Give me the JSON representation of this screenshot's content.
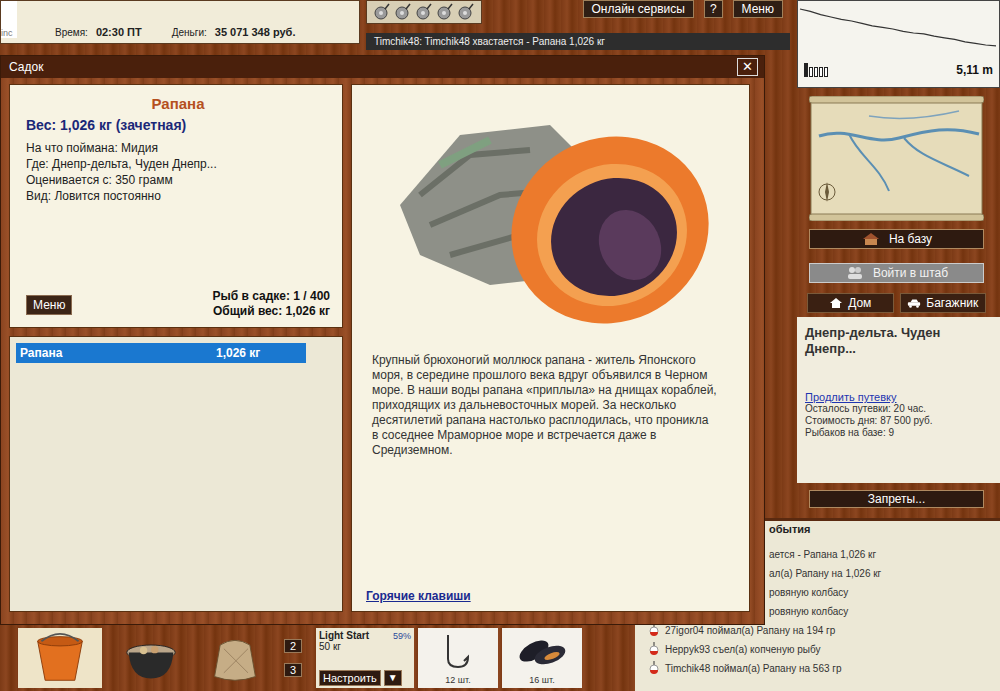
{
  "edge_fragment": "inc",
  "status": {
    "time_label": "Время:",
    "time": "02:30 ПТ",
    "money_label": "Деньги:",
    "money": "35 071 348 руб."
  },
  "top_buttons": {
    "online": "Онлайн сервисы",
    "help": "?",
    "menu": "Меню"
  },
  "chat": "Timchik48: Timchik48 хвастается - Рапана 1,026 кг",
  "depth": {
    "reading": "5,11 m",
    "profile": [
      0.5,
      0.8,
      1.2,
      1.5,
      1.8,
      2.0,
      2.3,
      2.6,
      2.8,
      3.0,
      3.3,
      3.5,
      3.6,
      3.9,
      4.1,
      4.3,
      4.6,
      4.8,
      5.0,
      5.11
    ],
    "battery": {
      "level": 0.2
    }
  },
  "right_panel": {
    "base_button": "На базу",
    "hq_button": {
      "label": "Войти в штаб",
      "disabled": true
    },
    "tabs": [
      {
        "label": "Дом",
        "kind": "home",
        "selected": false
      },
      {
        "label": "Багажник",
        "kind": "trunk",
        "selected": false
      }
    ],
    "location": "Днепр-дельта. Чуден Днепр...",
    "extend_link": "Продлить путевку",
    "info": [
      "Осталось путевки: 20 час.",
      "Стоимость дня: 87 500 руб.",
      "Рыбаков на базе: 9"
    ],
    "bans_button": "Запреты..."
  },
  "events": {
    "title": "обытия",
    "title_partial": true,
    "items": [
      {
        "text": "ается - Рапана 1,026 кг",
        "partial": true
      },
      {
        "text": "ал(а) Рапану на 1,026 кг",
        "partial": true
      },
      {
        "text": "ровяную колбасу",
        "partial": true
      },
      {
        "text": "ровяную колбасу",
        "partial": true
      },
      {
        "text": "27igor04 поймал(а) Рапану на 194 гр",
        "partial": false
      },
      {
        "text": "Heppyk93 съел(а) копченую рыбу",
        "partial": false
      },
      {
        "text": "Timchik48 поймал(а) Рапану на 563 гр",
        "partial": false
      }
    ]
  },
  "toolbar": {
    "tools": [
      {
        "kind": "bucket",
        "selected": true
      },
      {
        "kind": "pot",
        "selected": false
      },
      {
        "kind": "sack",
        "selected": false
      }
    ],
    "slots": [
      "2",
      "3"
    ],
    "rod": {
      "name": "Light Start",
      "load": "50 кг",
      "wear": "59%",
      "setup_button": "Настроить",
      "dropdown": "▼"
    },
    "items": [
      {
        "kind": "hook",
        "count": "12 шт."
      },
      {
        "kind": "mussel",
        "count": "16 шт."
      }
    ]
  },
  "modal": {
    "title": "Садок",
    "close": "✕",
    "fish_name": "Рапана",
    "weight": "Вес: 1,026 кг (зачетная)",
    "details": [
      "На что поймана: Мидия",
      "Где: Днепр-дельта, Чуден Днепр...",
      "Оценивается с: 350 грамм",
      "Вид: Ловится постоянно"
    ],
    "menu_button": "Меню",
    "count": "Рыб в садке: 1 / 400",
    "total": "Общий вес: 1,026 кг",
    "list": [
      {
        "name": "Рапана",
        "weight": "1,026 кг",
        "selected": true
      }
    ],
    "description": "Крупный брюхоногий моллюск рапана - житель Японского моря, в середине прошлого века вдруг объявился в Черном море. В наши воды рапана «приплыла» на днищах кораблей, приходящих из дальневосточных морей. За несколько десятилетий рапана настолько расплодилась, что проникла в соседнее Мраморное море и встречается даже в Средиземном.",
    "hotkeys_link": "Горячие клавиши"
  }
}
